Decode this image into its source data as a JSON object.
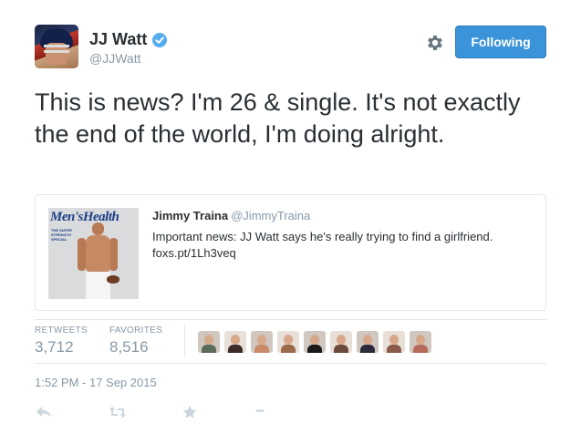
{
  "header": {
    "display_name": "JJ Watt",
    "handle": "@JJWatt",
    "follow_label": "Following",
    "accent": "#3b94d9"
  },
  "tweet": {
    "text": "This is news? I'm 26 & single. It's not exactly the end of the world, I'm doing alright."
  },
  "quoted": {
    "display_name": "Jimmy Traina",
    "handle": "@JimmyTraina",
    "text": "Important news: JJ Watt says he's really trying to find a girlfriend. foxs.pt/1Lh3veq",
    "image_title": "Men'sHealth",
    "image_subtitle": "THE SUPER STRENGTH SPECIAL"
  },
  "stats": {
    "retweets_label": "RETWEETS",
    "retweets_count": "3,712",
    "favorites_label": "FAVORITES",
    "favorites_count": "8,516"
  },
  "favoriters_colors": [
    "#5a6b5a",
    "#3a2a2a",
    "#c98a6a",
    "#9a6a4a",
    "#1a1a1a",
    "#6a4a3a",
    "#2a2a3a",
    "#8a5a4a",
    "#b56a5a"
  ],
  "timestamp": "1:52 PM - 17 Sep 2015",
  "actions": {
    "more_glyph": "•••"
  },
  "icons": [
    "verified-icon",
    "gear-icon",
    "reply-icon",
    "retweet-icon",
    "favorite-icon",
    "more-icon"
  ]
}
